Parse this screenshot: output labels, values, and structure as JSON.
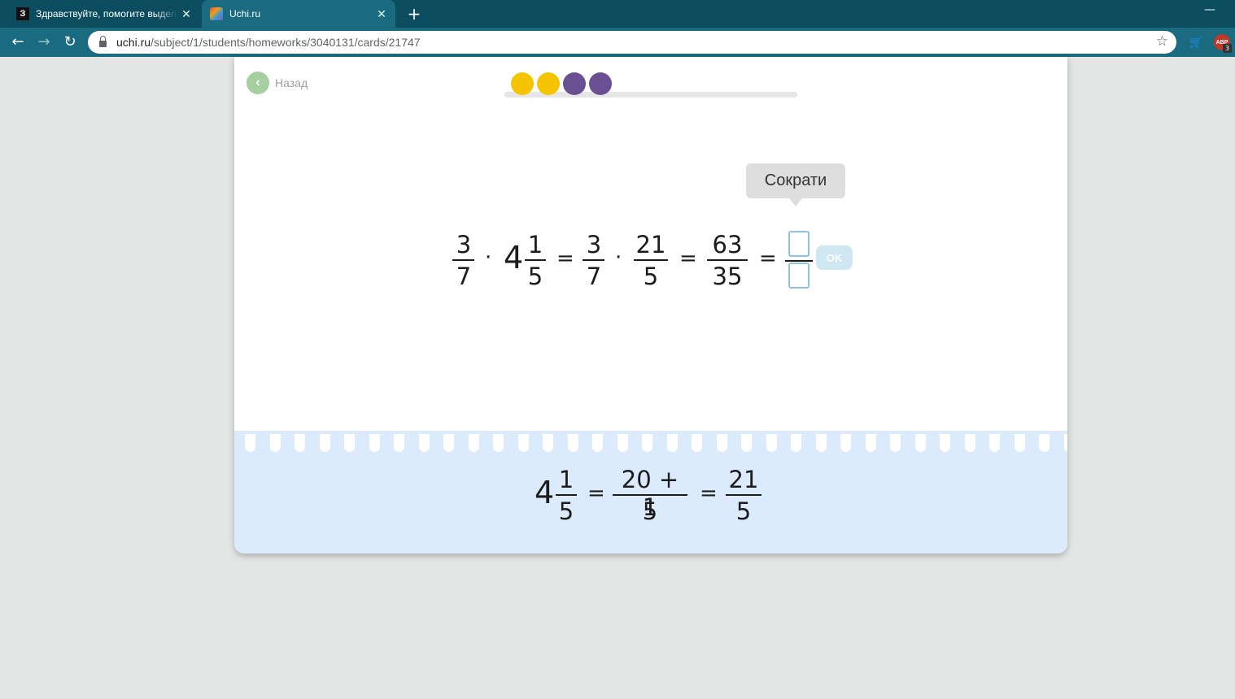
{
  "browser": {
    "tabs": [
      {
        "favicon": "З",
        "title": "Здравствуйте, помогите выдели"
      },
      {
        "title": "Uchi.ru"
      }
    ],
    "url_domain": "uchi.ru",
    "url_path": "/subject/1/students/homeworks/3040131/cards/21747",
    "ext_label": "ABP",
    "ext_badge": "3"
  },
  "card": {
    "back_label": "Назад",
    "progress_dots": [
      "#f5c400",
      "#f5c400",
      "#6b4f93",
      "#6b4f93"
    ],
    "tooltip": "Сократи",
    "equation": {
      "f1": {
        "num": "3",
        "den": "7"
      },
      "dot": "·",
      "mixed_whole": "4",
      "f2": {
        "num": "1",
        "den": "5"
      },
      "eq": "=",
      "f3": {
        "num": "3",
        "den": "7"
      },
      "f4": {
        "num": "21",
        "den": "5"
      },
      "f5": {
        "num": "63",
        "den": "35"
      }
    },
    "ok_label": "OK",
    "hint": {
      "whole": "4",
      "f1": {
        "num": "1",
        "den": "5"
      },
      "f2": {
        "num": "20 + 1",
        "den": "5"
      },
      "f3": {
        "num": "21",
        "den": "5"
      },
      "eq": "="
    }
  }
}
